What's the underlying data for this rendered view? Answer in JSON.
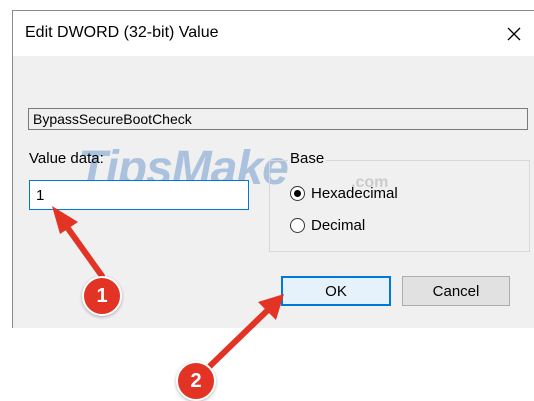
{
  "dialog": {
    "title": "Edit DWORD (32-bit) Value",
    "close_glyph": "✕",
    "value_name_field": "BypassSecureBootCheck",
    "value_data_label": "Value data:",
    "value_data_input": "1",
    "base": {
      "legend": "Base",
      "options": [
        {
          "label": "Hexadecimal",
          "selected": true
        },
        {
          "label": "Decimal",
          "selected": false
        }
      ]
    },
    "ok_label": "OK",
    "cancel_label": "Cancel"
  },
  "annotations": {
    "step1": "1",
    "step2": "2",
    "arrow_color": "#e23325"
  },
  "watermark": {
    "main": "TipsMake",
    "suffix": ".com"
  }
}
